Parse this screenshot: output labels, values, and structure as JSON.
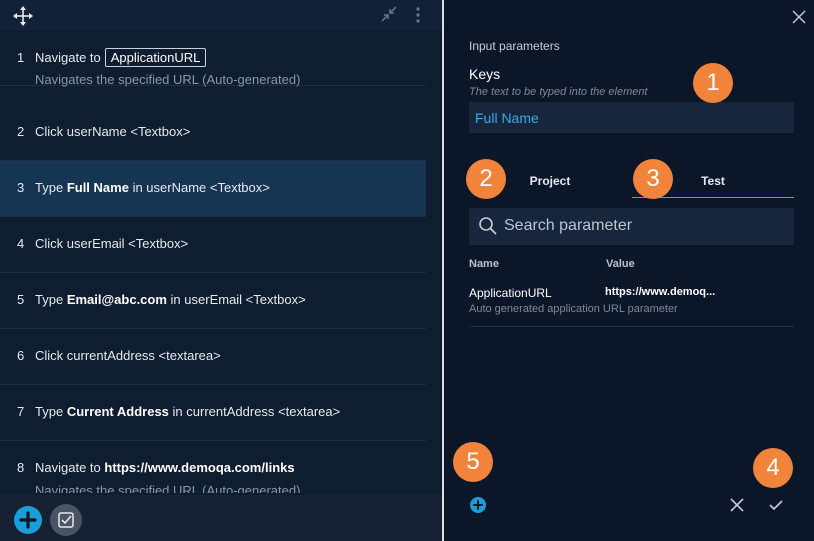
{
  "steps": [
    {
      "num": "1",
      "pre": "Navigate to",
      "chip": "ApplicationURL",
      "sub": "Navigates the specified URL (Auto-generated)"
    },
    {
      "num": "2",
      "pre": "Click userName <Textbox>"
    },
    {
      "num": "3",
      "pre": "Type",
      "bold": "Full Name",
      "post": "in userName <Textbox>"
    },
    {
      "num": "4",
      "pre": "Click userEmail <Textbox>"
    },
    {
      "num": "5",
      "pre": "Type",
      "bold": "Email@abc.com",
      "post": "in userEmail <Textbox>"
    },
    {
      "num": "6",
      "pre": "Click currentAddress <textarea>"
    },
    {
      "num": "7",
      "pre": "Type",
      "bold": "Current Address",
      "post": "in currentAddress <textarea>"
    },
    {
      "num": "8",
      "pre": "Navigate to",
      "bold": "https://www.demoqa.com/links",
      "sub": "Navigates the specified URL (Auto-generated)"
    }
  ],
  "panel": {
    "section_label": "Input parameters",
    "keys_label": "Keys",
    "keys_hint": "The text to be typed into the element",
    "keys_value": "Full Name",
    "tabs": {
      "project": "Project",
      "test": "Test"
    },
    "search_placeholder": "Search parameter",
    "columns": {
      "name": "Name",
      "value": "Value"
    },
    "params": [
      {
        "name": "ApplicationURL",
        "value": "https://www.demoq...",
        "desc": "Auto generated application URL parameter"
      }
    ]
  },
  "badges": [
    "1",
    "2",
    "3",
    "4",
    "5"
  ],
  "colors": {
    "accent": "#1a9ed9",
    "badge": "#f2833a",
    "selected_row": "#153553",
    "link_text": "#39a9e6"
  }
}
